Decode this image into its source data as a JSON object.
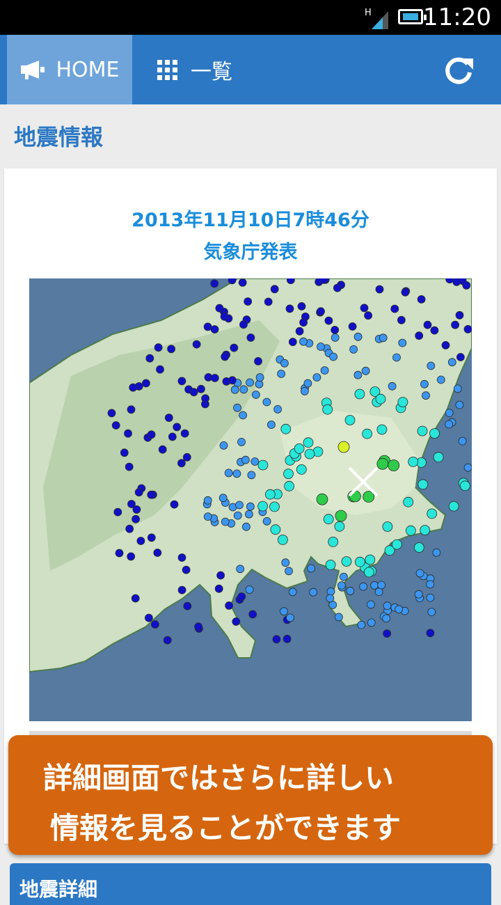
{
  "status_bar": {
    "time": "11:20",
    "network": "H",
    "icons": [
      "signal-icon",
      "battery-icon"
    ]
  },
  "nav": {
    "home_label": "HOME",
    "home_icon": "megaphone-icon",
    "list_label": "一覧",
    "list_icon": "grid-icon",
    "refresh_icon": "refresh-icon"
  },
  "page": {
    "section_title": "地震情報"
  },
  "report": {
    "datetime": "2013年11月10日7時46分",
    "source": "気象庁発表"
  },
  "toast": {
    "line1": "詳細画面ではさらに詳しい",
    "line2": "情報を見ることができます"
  },
  "detail": {
    "title": "地震詳細"
  },
  "colors": {
    "navbar": "#2c78c4",
    "nav_active": "#6ea4da",
    "accent_text": "#1a8ddb",
    "toast": "#d5660f",
    "sea": "#567aa0",
    "land": "#cfe0c4",
    "intensity_1": "#1010c8",
    "intensity_2": "#3c96f0",
    "intensity_3": "#28e6d8",
    "intensity_4": "#2ecc4a",
    "intensity_5": "#d8f028"
  }
}
